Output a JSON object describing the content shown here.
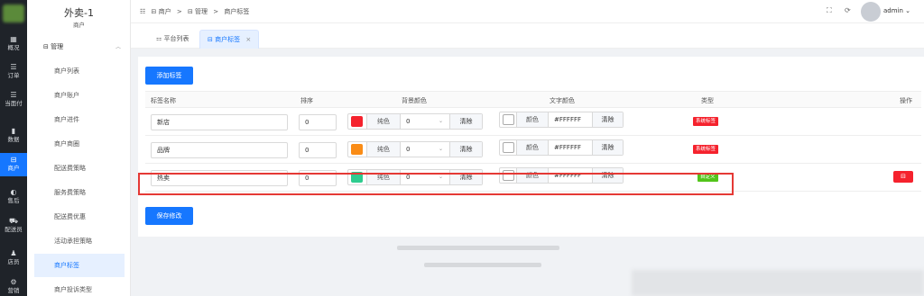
{
  "rail": [
    {
      "icon": "▦",
      "label": "概况"
    },
    {
      "icon": "☰",
      "label": "订单"
    },
    {
      "icon": "☰",
      "label": "当面付"
    },
    {
      "icon": "▮",
      "label": "数据"
    },
    {
      "icon": "⊟",
      "label": "商户"
    },
    {
      "icon": "◐",
      "label": "售后"
    },
    {
      "icon": "⛟",
      "label": "配送员"
    },
    {
      "icon": "♟",
      "label": "店员"
    },
    {
      "icon": "⚙",
      "label": "营销"
    }
  ],
  "brand": {
    "title": "外卖-1",
    "subtitle": "商户"
  },
  "menu": {
    "group_label": "⊟ 管理",
    "items": [
      "商户列表",
      "商户账户",
      "商户进件",
      "商户商圈",
      "配送费策略",
      "服务费策略",
      "配送费优惠",
      "活动承担策略",
      "商户标签",
      "商户投诉类型"
    ]
  },
  "header": {
    "menu_toggle": "☷",
    "crumbs": [
      "⊟ 商户",
      ">",
      "⊟ 管理",
      ">",
      "商户标签"
    ],
    "fullscreen": "⛶",
    "refresh": "⟳",
    "username": "admin ⌄"
  },
  "tabs": [
    {
      "label": "⚏ 平台列表"
    },
    {
      "label": "⊟ 商户标签",
      "close": "×"
    }
  ],
  "toolbar": {
    "add_label": "添加标签",
    "save_label": "保存修改"
  },
  "table": {
    "headers": [
      "标签名称",
      "排序",
      "背景颜色",
      "文字颜色",
      "类型",
      "操作"
    ],
    "rows": [
      {
        "name": "新店",
        "sort": "0",
        "bg_color": "#f5222d",
        "bg_mode": "纯色",
        "bg_value": "0",
        "bg_clear": "清除",
        "text_mode": "颜色",
        "text_color": "#FFFFFF",
        "text_clear": "清除",
        "type": "系统标签",
        "type_color": "#f5222d"
      },
      {
        "name": "品牌",
        "sort": "0",
        "bg_color": "#fa8c16",
        "bg_mode": "纯色",
        "bg_value": "0",
        "bg_clear": "清除",
        "text_mode": "颜色",
        "text_color": "#FFFFFF",
        "text_clear": "清除",
        "type": "系统标签",
        "type_color": "#f5222d"
      },
      {
        "name": "热卖",
        "sort": "0",
        "bg_color": "#2ecc8f",
        "bg_mode": "纯色",
        "bg_value": "0",
        "bg_clear": "清除",
        "text_mode": "颜色",
        "text_color": "#FFFFFF",
        "text_clear": "清除",
        "type": "自定义",
        "type_color": "#52c41a",
        "action": "⊟"
      }
    ]
  },
  "colors": {
    "accent": "#1677ff",
    "danger": "#f5222d",
    "success": "#52c41a"
  }
}
